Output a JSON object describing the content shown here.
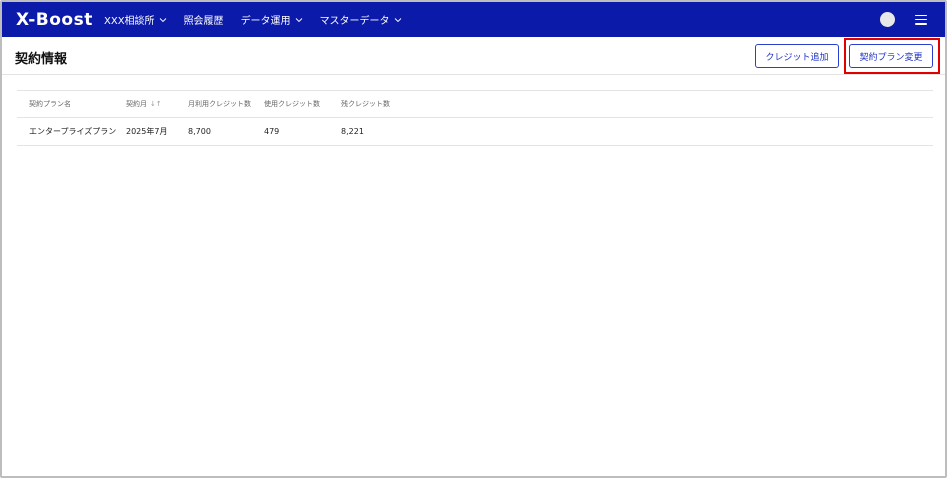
{
  "navbar": {
    "logo": "X-Boost",
    "items": [
      {
        "label": "XXX相談所",
        "has_dropdown": true
      },
      {
        "label": "照会履歴",
        "has_dropdown": false
      },
      {
        "label": "データ運用",
        "has_dropdown": true
      },
      {
        "label": "マスターデータ",
        "has_dropdown": true
      }
    ],
    "bg_color": "#0b1aa8"
  },
  "header": {
    "title": "契約情報",
    "credit_button": "クレジット追加",
    "plan_button": "契約プラン変更"
  },
  "table": {
    "columns": [
      "契約プラン名",
      "契約月",
      "月利用クレジット数",
      "使用クレジット数",
      "残クレジット数"
    ],
    "sort_icon": "↓↑",
    "rows": [
      [
        "エンタープライズプラン",
        "2025年7月",
        "8,700",
        "479",
        "8,221"
      ]
    ]
  }
}
